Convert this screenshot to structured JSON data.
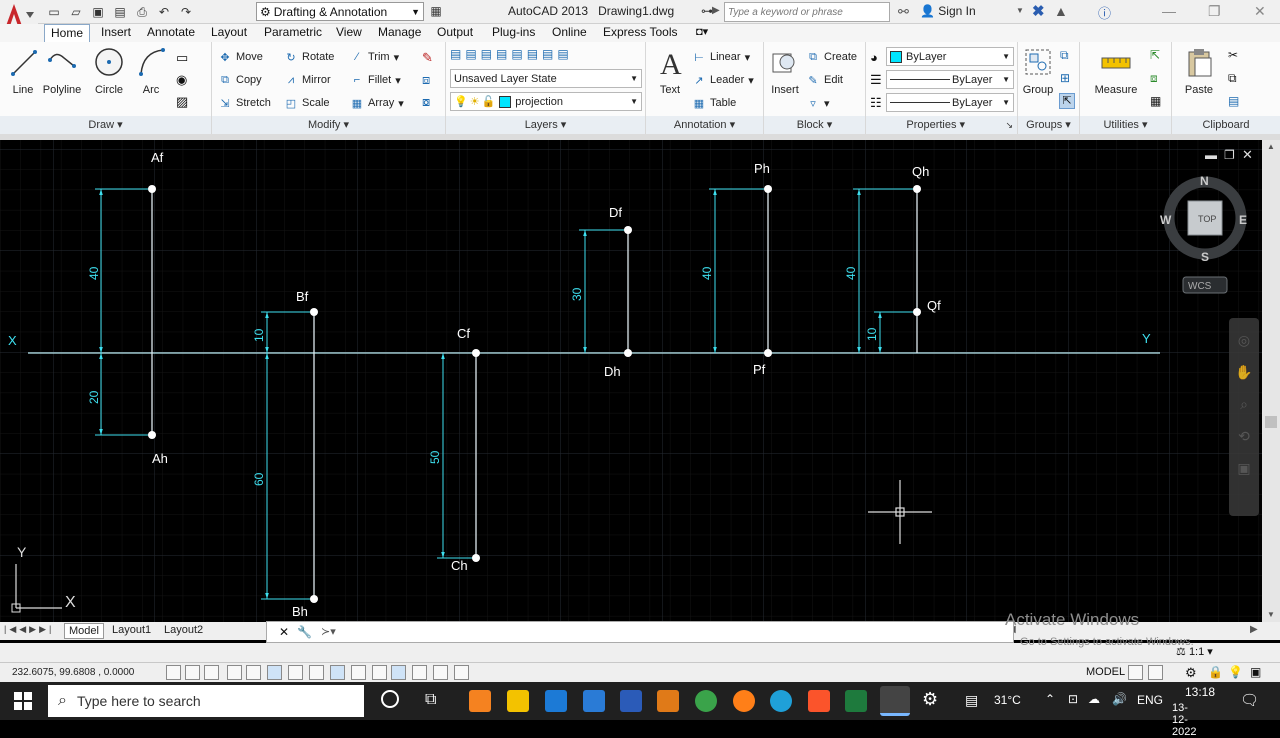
{
  "window": {
    "workspace": "Drafting & Annotation",
    "app_title": "AutoCAD 2013",
    "file_title": "Drawing1.dwg",
    "search_placeholder": "Type a keyword or phrase",
    "sign_in": "Sign In"
  },
  "ribbon_tabs": [
    "Home",
    "Insert",
    "Annotate",
    "Layout",
    "Parametric",
    "View",
    "Manage",
    "Output",
    "Plug-ins",
    "Online",
    "Express Tools"
  ],
  "draw": {
    "title": "Draw",
    "line": "Line",
    "polyline": "Polyline",
    "circle": "Circle",
    "arc": "Arc"
  },
  "modify": {
    "title": "Modify",
    "move": "Move",
    "rotate": "Rotate",
    "trim": "Trim",
    "copy": "Copy",
    "mirror": "Mirror",
    "fillet": "Fillet",
    "stretch": "Stretch",
    "scale": "Scale",
    "array": "Array"
  },
  "layers": {
    "title": "Layers",
    "state": "Unsaved Layer State",
    "current": "projection"
  },
  "annotation": {
    "title": "Annotation",
    "text": "Text",
    "linear": "Linear",
    "leader": "Leader",
    "table": "Table"
  },
  "block": {
    "title": "Block",
    "insert": "Insert",
    "create": "Create",
    "edit": "Edit"
  },
  "properties": {
    "title": "Properties",
    "color": "ByLayer",
    "linetype": "ByLayer",
    "lineweight": "ByLayer"
  },
  "groups": {
    "title": "Groups",
    "group": "Group"
  },
  "utilities": {
    "title": "Utilities",
    "measure": "Measure"
  },
  "clipboard": {
    "title": "Clipboard",
    "paste": "Paste"
  },
  "drawing": {
    "xy_left": "X",
    "xy_right": "Y",
    "labels": {
      "af": "Af",
      "ah": "Ah",
      "bf": "Bf",
      "bh": "Bh",
      "cf": "Cf",
      "ch": "Ch",
      "df": "Df",
      "dh": "Dh",
      "ph": "Ph",
      "pf": "Pf",
      "qh": "Qh",
      "qf": "Qf"
    },
    "dims": {
      "a_up": "40",
      "a_down": "20",
      "b_up": "10",
      "b_down": "60",
      "c_down": "50",
      "d_up": "30",
      "p_up": "40",
      "q_up": "40",
      "q_f": "10"
    },
    "ucs_y": "Y",
    "ucs_x": "X"
  },
  "viewcube": {
    "n": "N",
    "s": "S",
    "e": "E",
    "w": "W",
    "top": "TOP",
    "wcs": "WCS"
  },
  "layout_tabs": [
    "Model",
    "Layout1",
    "Layout2"
  ],
  "status": {
    "coords": "232.6075, 99.6808 , 0.0000",
    "model": "MODEL",
    "scale": "1:1"
  },
  "watermark": {
    "line1": "Activate Windows",
    "line2": "Go to Settings to activate Windows."
  },
  "taskbar": {
    "search": "Type here to search",
    "temp": "31°C",
    "lang": "ENG",
    "time": "13:18",
    "date": "13-12-2022"
  }
}
